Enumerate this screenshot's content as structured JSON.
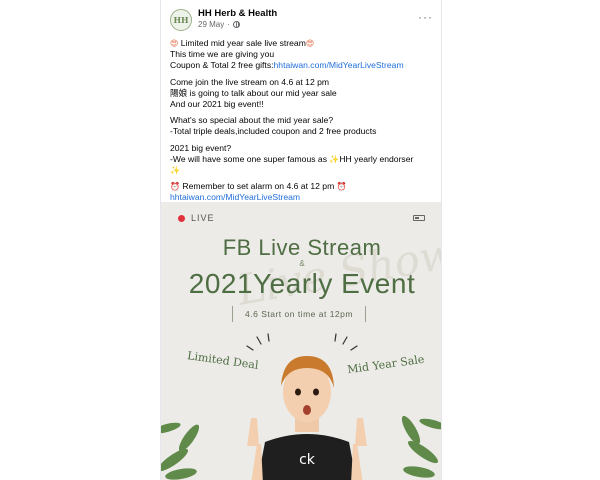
{
  "post": {
    "page_name": "HH Herb & Health",
    "avatar_text": "HH",
    "date": "29 May",
    "more_label": "···",
    "lines": [
      {
        "pre_emoji": "😍",
        "text": " Limited mid year sale live stream",
        "post_emoji": "😍"
      },
      {
        "text": "This time we are giving you"
      },
      {
        "text": "Coupon & Total 2 free gifts:",
        "link": "hhtaiwan.com/MidYearLiveStream"
      },
      {
        "text": "Come join the live stream on 4.6 at 12 pm"
      },
      {
        "text": "陽娘 is going to talk about our mid year sale"
      },
      {
        "text": "And our 2021 big event!!"
      },
      {
        "text": "What's so special about the mid year sale?"
      },
      {
        "text": "-Total triple deals,included coupon and 2 free products"
      },
      {
        "text": "2021 big event?"
      },
      {
        "text": "-We will have some one super famous as ",
        "emoji": "✨",
        "text2": "HH yearly endorser"
      },
      {
        "emoji": "✨"
      },
      {
        "pre_emoji": "⏰",
        "text": " Remember to set alarm on 4.6 at 12 pm ",
        "post_emoji": "⏰"
      },
      {
        "link": "hhtaiwan.com/MidYearLiveStream"
      }
    ]
  },
  "banner": {
    "live_label": "LIVE",
    "watermark": "Live Show",
    "title_line1": "FB Live Stream",
    "amp": "&",
    "title_line2": "2021Yearly Event",
    "time_pill": "4.6  Start on time at 12pm",
    "tag_left": "Limited Deal",
    "tag_right": "Mid Year Sale"
  },
  "colors": {
    "title_green": "#4f6e44",
    "link_blue": "#216fdb",
    "live_red": "#e0323b",
    "banner_bg": "#ecebe7"
  },
  "icons": [
    "globe-icon",
    "more-icon",
    "live-dot-icon",
    "battery-icon"
  ]
}
